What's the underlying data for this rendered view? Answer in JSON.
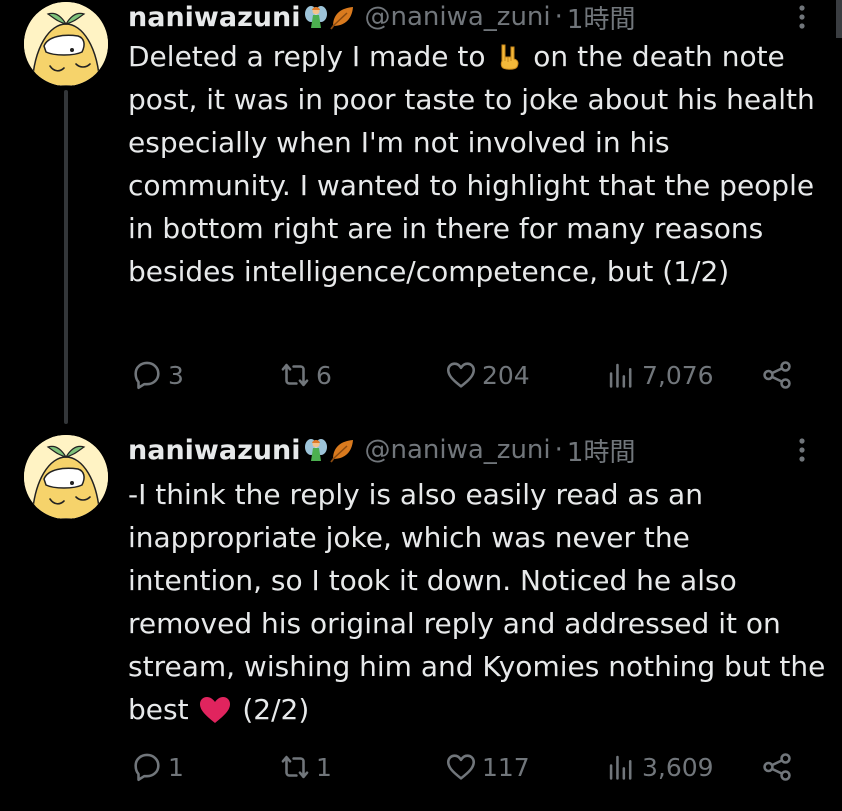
{
  "thread": [
    {
      "author": {
        "display_name": "naniwazuni",
        "handle": "@naniwa_zuni",
        "decorations": [
          "fairy-emoji",
          "fallen-leaf-emoji"
        ]
      },
      "timestamp": "1時間",
      "separator": "·",
      "text_before_emoji": "Deleted a reply I made to ",
      "inline_emoji": "sign-of-horns-emoji",
      "text_after_emoji": " on the death note post, it was in poor taste to joke about his health especially when I'm not involved in his community. I wanted to highlight that the people in bottom right are in there for many reasons besides intelligence/competence, but (1/2)",
      "stats": {
        "replies": "3",
        "retweets": "6",
        "likes": "204",
        "views": "7,076"
      }
    },
    {
      "author": {
        "display_name": "naniwazuni",
        "handle": "@naniwa_zuni",
        "decorations": [
          "fairy-emoji",
          "fallen-leaf-emoji"
        ]
      },
      "timestamp": "1時間",
      "separator": "·",
      "text_before_emoji": "-I think the reply is also easily read as an inappropriate joke, which was never the intention, so I took it down. Noticed he also removed his original reply and addressed it on stream, wishing him and Kyomies nothing but the best ",
      "inline_emoji": "red-heart-emoji",
      "text_after_emoji": " (2/2)",
      "stats": {
        "replies": "1",
        "retweets": "1",
        "likes": "117",
        "views": "3,609"
      }
    }
  ],
  "colors": {
    "background": "#000000",
    "primary_text": "#e7e9ea",
    "secondary_text": "#71767b",
    "thread_line": "#333639",
    "heart": "#e0245e"
  }
}
